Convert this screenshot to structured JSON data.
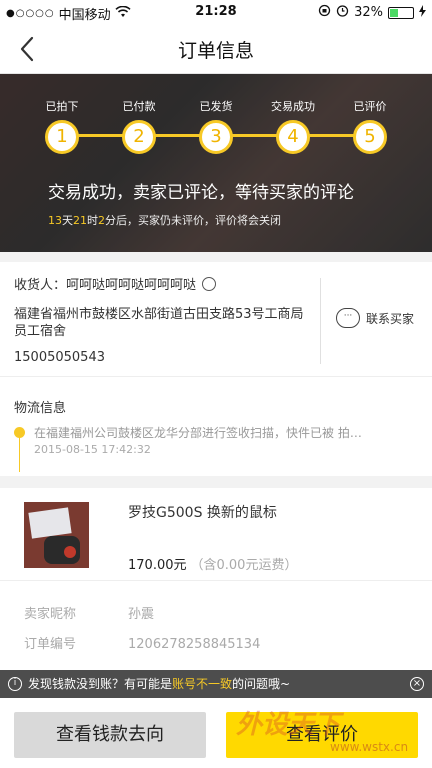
{
  "status_bar": {
    "signal": "●○○○○",
    "carrier": "中国移动",
    "time": "21:28",
    "battery_pct": "32%",
    "battery_level": 0.32
  },
  "nav": {
    "title": "订单信息"
  },
  "progress": {
    "steps": [
      {
        "label": "已拍下",
        "num": "1"
      },
      {
        "label": "已付款",
        "num": "2"
      },
      {
        "label": "已发货",
        "num": "3"
      },
      {
        "label": "交易成功",
        "num": "4"
      },
      {
        "label": "已评价",
        "num": "5"
      }
    ],
    "message": "交易成功，卖家已评论，等待买家的评论",
    "countdown": {
      "days": "13",
      "days_unit": "天",
      "hours": "21",
      "hours_unit": "时",
      "minutes": "2",
      "minutes_unit": "分后，买家仍未评价，评价将会关闭"
    }
  },
  "address": {
    "receiver": "收货人：呵呵哒呵呵哒呵呵呵哒",
    "street": "福建省福州市鼓楼区水部街道古田支路53号工商局员工宿舍",
    "phone": "15005050543",
    "contact_label": "联系买家"
  },
  "logistics": {
    "header": "物流信息",
    "latest": "在福建福州公司鼓楼区龙华分部进行签收扫描，快件已被 拍…",
    "time": "2015-08-15 17:42:32"
  },
  "product": {
    "name": "罗技G500S 换新的鼠标",
    "price": "170.00元",
    "shipping": "（含0.00元运费）"
  },
  "details": [
    {
      "key": "卖家昵称",
      "value": "孙震"
    },
    {
      "key": "订单编号",
      "value": "1206278258845134"
    }
  ],
  "toast": {
    "prefix": "发现钱款没到账？有可能是",
    "highlight": "账号不一致",
    "suffix": "的问题哦~"
  },
  "buttons": {
    "money": "查看钱款去向",
    "review": "查看评价"
  },
  "watermark": {
    "logo": "外设天下",
    "url": "www.wstx.cn"
  }
}
